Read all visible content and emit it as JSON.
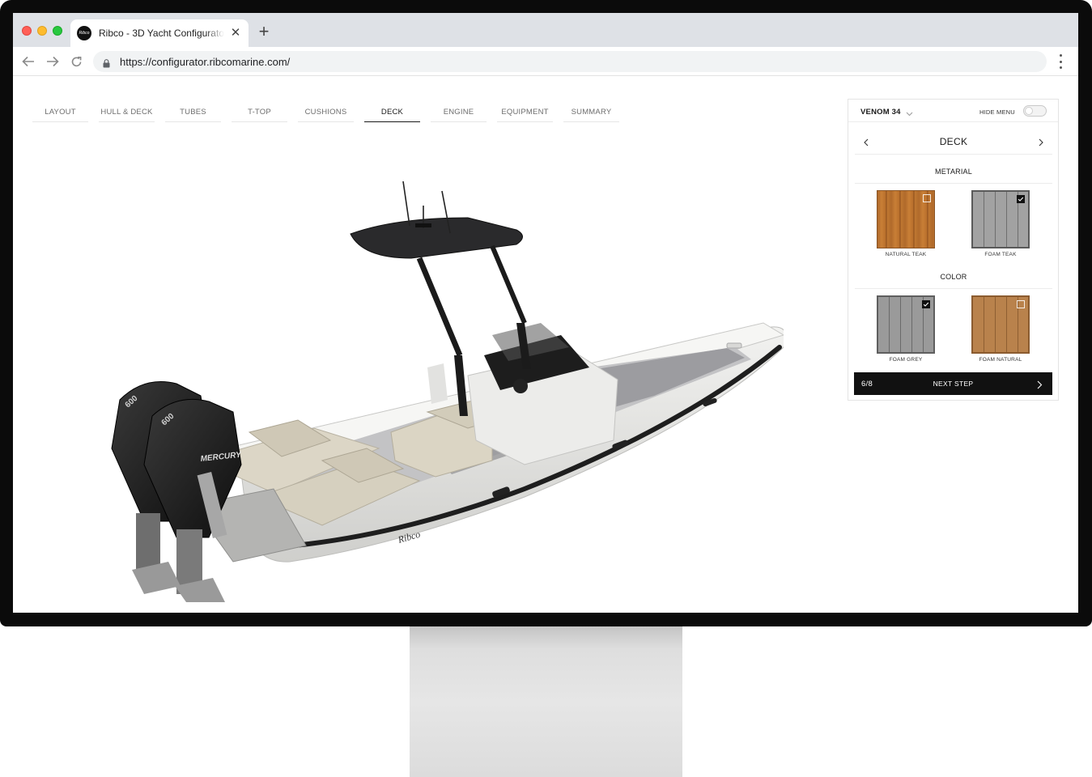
{
  "browser": {
    "tab_title": "Ribco - 3D Yacht Configurator",
    "favicon_text": "Ribco",
    "url": "https://configurator.ribcomarine.com/",
    "icons": [
      "back-arrow-icon",
      "forward-arrow-icon",
      "reload-icon",
      "lock-icon",
      "kebab-menu-icon",
      "close-icon",
      "plus-icon"
    ]
  },
  "steps": [
    {
      "label": "LAYOUT",
      "active": false
    },
    {
      "label": "HULL & DECK",
      "active": false
    },
    {
      "label": "TUBES",
      "active": false
    },
    {
      "label": "T-TOP",
      "active": false
    },
    {
      "label": "CUSHIONS",
      "active": false
    },
    {
      "label": "DECK",
      "active": true
    },
    {
      "label": "ENGINE",
      "active": false
    },
    {
      "label": "EQUIPMENT",
      "active": false
    },
    {
      "label": "SUMMARY",
      "active": false
    }
  ],
  "boat": {
    "brand_mark": "Ribco",
    "engine_brand": "MERCURY",
    "engine_model": "600"
  },
  "panel": {
    "model": "VENOM 34",
    "hide_menu_label": "HIDE MENU",
    "hide_menu_on": false,
    "section_title": "DECK",
    "material_title": "METARIAL",
    "material_options": [
      {
        "label": "NATURAL TEAK",
        "selected": false
      },
      {
        "label": "FOAM TEAK",
        "selected": true
      }
    ],
    "color_title": "COLOR",
    "color_options": [
      {
        "label": "FOAM GREY",
        "selected": true
      },
      {
        "label": "FOAM NATURAL",
        "selected": false
      }
    ],
    "step_count": "6/8",
    "next_label": "NEXT STEP"
  },
  "colors": {
    "accent": "#111111",
    "natural_teak": "#b06a2b",
    "foam_grey": "#9a9a9a",
    "foam_natural": "#b9824c",
    "hull": "#e9e9e6",
    "deck": "#9c9ca0"
  }
}
